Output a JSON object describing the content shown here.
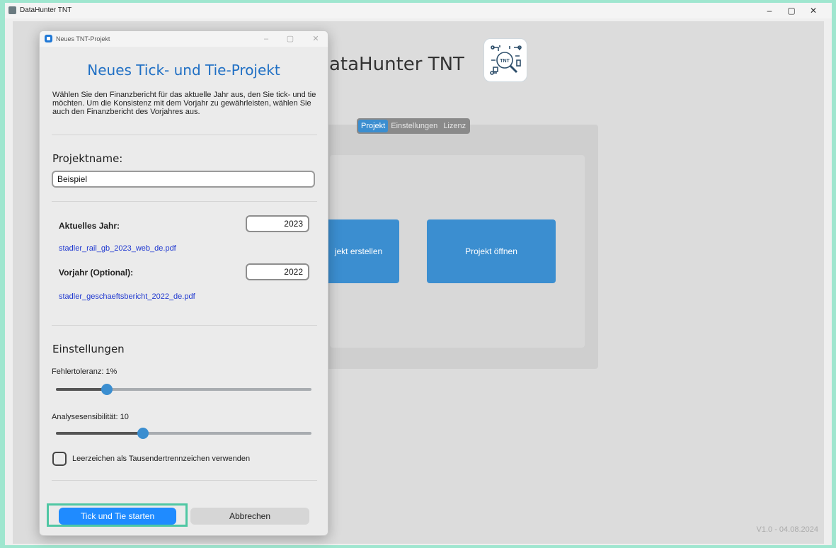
{
  "main_window": {
    "title": "DataHunter TNT",
    "minimize": "–",
    "restore": "▢",
    "close": "✕"
  },
  "main": {
    "app_title": "ataHunter TNT",
    "tabs": [
      {
        "label": "Projekt",
        "active": true
      },
      {
        "label": "Einstellungen",
        "active": false
      },
      {
        "label": "Lizenz",
        "active": false
      }
    ],
    "create_button": "jekt erstellen",
    "open_button": "Projekt öffnen",
    "version": "V1.0 - 04.08.2024",
    "logo_text": "TNT"
  },
  "dialog": {
    "window_title": "Neues TNT-Projekt",
    "heading": "Neues Tick- und Tie-Projekt",
    "description": "Wählen Sie den Finanzbericht für das aktuelle Jahr aus, den Sie tick- und tie möchten. Um die Konsistenz mit dem Vorjahr zu gewährleisten, wählen Sie auch den Finanzbericht des Vorjahres aus.",
    "project_name_label": "Projektname:",
    "project_name_value": "Beispiel",
    "current_year_label": "Aktuelles Jahr:",
    "current_year_value": "2023",
    "current_file": "stadler_rail_gb_2023_web_de.pdf",
    "prev_year_label": "Vorjahr (Optional):",
    "prev_year_value": "2022",
    "prev_file": "stadler_geschaeftsbericht_2022_de.pdf",
    "settings_label": "Einstellungen",
    "error_tolerance_label": "Fehlertoleranz: 1%",
    "error_tolerance_level": 0.2,
    "sensitivity_label": "Analysesensibilität: 10",
    "sensitivity_level": 0.34,
    "checkbox_label": "Leerzeichen als Tausendertrennzeichen verwenden",
    "checkbox_checked": false,
    "start_button": "Tick und Tie starten",
    "cancel_button": "Abbrechen"
  },
  "colors": {
    "accent": "#3b8ed0",
    "primary_button": "#1f8bff",
    "heading": "#1f6fc4",
    "link": "#1f38d0",
    "highlight": "#4fc7a3"
  }
}
